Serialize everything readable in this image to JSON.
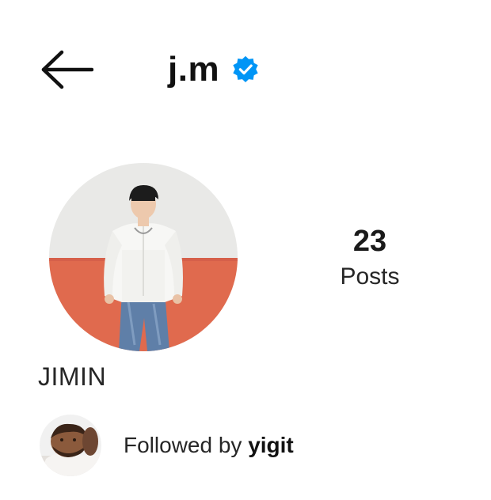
{
  "header": {
    "back_icon": "arrow-left-icon",
    "username": "j.m",
    "verified_icon": "verified-badge-icon",
    "verified_color": "#0095F6"
  },
  "profile": {
    "avatar_description_icon": "profile-photo",
    "display_name": "JIMIN",
    "stats": {
      "posts_value": "23",
      "posts_label": "Posts"
    }
  },
  "followed_by": {
    "prefix": "Followed by",
    "name": "yigit"
  }
}
